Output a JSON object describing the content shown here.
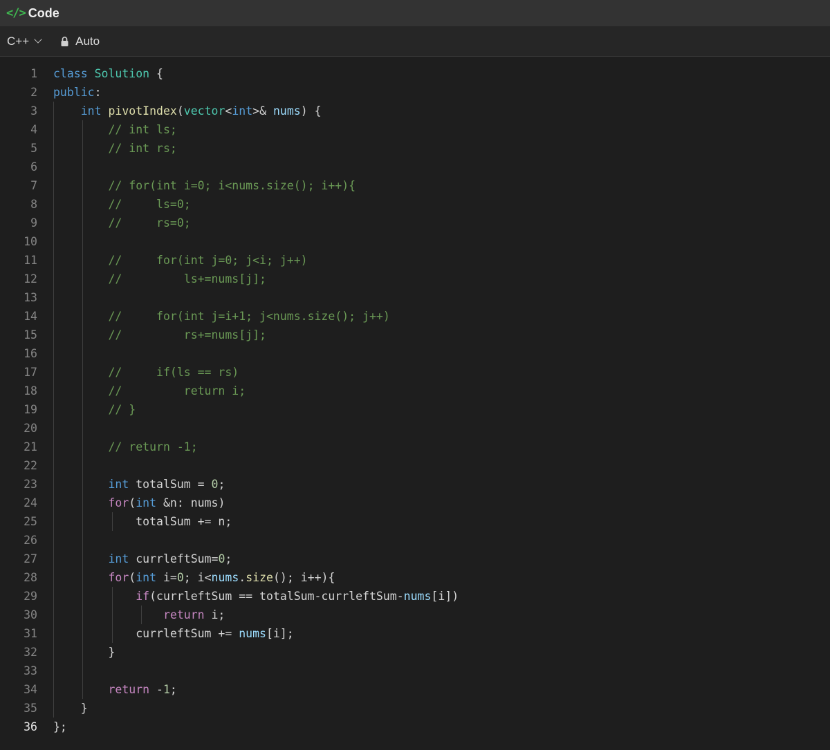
{
  "header": {
    "icon": "code-icon",
    "title": "Code",
    "icon_color": "#3fb950"
  },
  "toolbar": {
    "language": "C++",
    "mode_icon": "lock-icon",
    "mode": "Auto"
  },
  "editor": {
    "active_line": 36,
    "lines": [
      {
        "n": "1",
        "tokens": [
          [
            "kw",
            "class"
          ],
          [
            "op",
            " "
          ],
          [
            "type",
            "Solution"
          ],
          [
            "op",
            " {"
          ]
        ]
      },
      {
        "n": "2",
        "tokens": [
          [
            "kw",
            "public"
          ],
          [
            "op",
            ":"
          ]
        ]
      },
      {
        "n": "3",
        "tokens": [
          [
            "op",
            "    "
          ],
          [
            "kw",
            "int"
          ],
          [
            "op",
            " "
          ],
          [
            "fn",
            "pivotIndex"
          ],
          [
            "op",
            "("
          ],
          [
            "type",
            "vector"
          ],
          [
            "op",
            "<"
          ],
          [
            "kw",
            "int"
          ],
          [
            "op",
            ">& "
          ],
          [
            "var",
            "nums"
          ],
          [
            "op",
            ") {"
          ]
        ]
      },
      {
        "n": "4",
        "tokens": [
          [
            "op",
            "        "
          ],
          [
            "cm",
            "// int ls;"
          ]
        ]
      },
      {
        "n": "5",
        "tokens": [
          [
            "op",
            "        "
          ],
          [
            "cm",
            "// int rs;"
          ]
        ]
      },
      {
        "n": "6",
        "tokens": []
      },
      {
        "n": "7",
        "tokens": [
          [
            "op",
            "        "
          ],
          [
            "cm",
            "// for(int i=0; i<nums.size(); i++){"
          ]
        ]
      },
      {
        "n": "8",
        "tokens": [
          [
            "op",
            "        "
          ],
          [
            "cm",
            "//     ls=0;"
          ]
        ]
      },
      {
        "n": "9",
        "tokens": [
          [
            "op",
            "        "
          ],
          [
            "cm",
            "//     rs=0;"
          ]
        ]
      },
      {
        "n": "10",
        "tokens": []
      },
      {
        "n": "11",
        "tokens": [
          [
            "op",
            "        "
          ],
          [
            "cm",
            "//     for(int j=0; j<i; j++)"
          ]
        ]
      },
      {
        "n": "12",
        "tokens": [
          [
            "op",
            "        "
          ],
          [
            "cm",
            "//         ls+=nums[j];"
          ]
        ]
      },
      {
        "n": "13",
        "tokens": []
      },
      {
        "n": "14",
        "tokens": [
          [
            "op",
            "        "
          ],
          [
            "cm",
            "//     for(int j=i+1; j<nums.size(); j++)"
          ]
        ]
      },
      {
        "n": "15",
        "tokens": [
          [
            "op",
            "        "
          ],
          [
            "cm",
            "//         rs+=nums[j];"
          ]
        ]
      },
      {
        "n": "16",
        "tokens": []
      },
      {
        "n": "17",
        "tokens": [
          [
            "op",
            "        "
          ],
          [
            "cm",
            "//     if(ls == rs)"
          ]
        ]
      },
      {
        "n": "18",
        "tokens": [
          [
            "op",
            "        "
          ],
          [
            "cm",
            "//         return i;"
          ]
        ]
      },
      {
        "n": "19",
        "tokens": [
          [
            "op",
            "        "
          ],
          [
            "cm",
            "// }"
          ]
        ]
      },
      {
        "n": "20",
        "tokens": []
      },
      {
        "n": "21",
        "tokens": [
          [
            "op",
            "        "
          ],
          [
            "cm",
            "// return -1;"
          ]
        ]
      },
      {
        "n": "22",
        "tokens": []
      },
      {
        "n": "23",
        "tokens": [
          [
            "op",
            "        "
          ],
          [
            "kw",
            "int"
          ],
          [
            "op",
            " totalSum = "
          ],
          [
            "num",
            "0"
          ],
          [
            "op",
            ";"
          ]
        ]
      },
      {
        "n": "24",
        "tokens": [
          [
            "op",
            "        "
          ],
          [
            "ctrl",
            "for"
          ],
          [
            "op",
            "("
          ],
          [
            "kw",
            "int"
          ],
          [
            "op",
            " &n: nums)"
          ]
        ]
      },
      {
        "n": "25",
        "tokens": [
          [
            "op",
            "            totalSum += n;"
          ]
        ]
      },
      {
        "n": "26",
        "tokens": []
      },
      {
        "n": "27",
        "tokens": [
          [
            "op",
            "        "
          ],
          [
            "kw",
            "int"
          ],
          [
            "op",
            " currleftSum="
          ],
          [
            "num",
            "0"
          ],
          [
            "op",
            ";"
          ]
        ]
      },
      {
        "n": "28",
        "tokens": [
          [
            "op",
            "        "
          ],
          [
            "ctrl",
            "for"
          ],
          [
            "op",
            "("
          ],
          [
            "kw",
            "int"
          ],
          [
            "op",
            " i="
          ],
          [
            "num",
            "0"
          ],
          [
            "op",
            "; i<"
          ],
          [
            "var",
            "nums"
          ],
          [
            "op",
            "."
          ],
          [
            "fn",
            "size"
          ],
          [
            "op",
            "(); i++){"
          ]
        ]
      },
      {
        "n": "29",
        "tokens": [
          [
            "op",
            "            "
          ],
          [
            "ctrl",
            "if"
          ],
          [
            "op",
            "(currleftSum == totalSum-currleftSum-"
          ],
          [
            "var",
            "nums"
          ],
          [
            "op",
            "[i])"
          ]
        ]
      },
      {
        "n": "30",
        "tokens": [
          [
            "op",
            "                "
          ],
          [
            "ctrl",
            "return"
          ],
          [
            "op",
            " i;"
          ]
        ]
      },
      {
        "n": "31",
        "tokens": [
          [
            "op",
            "            currleftSum += "
          ],
          [
            "var",
            "nums"
          ],
          [
            "op",
            "[i];"
          ]
        ]
      },
      {
        "n": "32",
        "tokens": [
          [
            "op",
            "        }"
          ]
        ]
      },
      {
        "n": "33",
        "tokens": []
      },
      {
        "n": "34",
        "tokens": [
          [
            "op",
            "        "
          ],
          [
            "ctrl",
            "return"
          ],
          [
            "op",
            " -"
          ],
          [
            "num",
            "1"
          ],
          [
            "op",
            ";"
          ]
        ]
      },
      {
        "n": "35",
        "tokens": [
          [
            "op",
            "    }"
          ]
        ]
      },
      {
        "n": "36",
        "tokens": [
          [
            "op",
            "};"
          ]
        ]
      }
    ]
  }
}
